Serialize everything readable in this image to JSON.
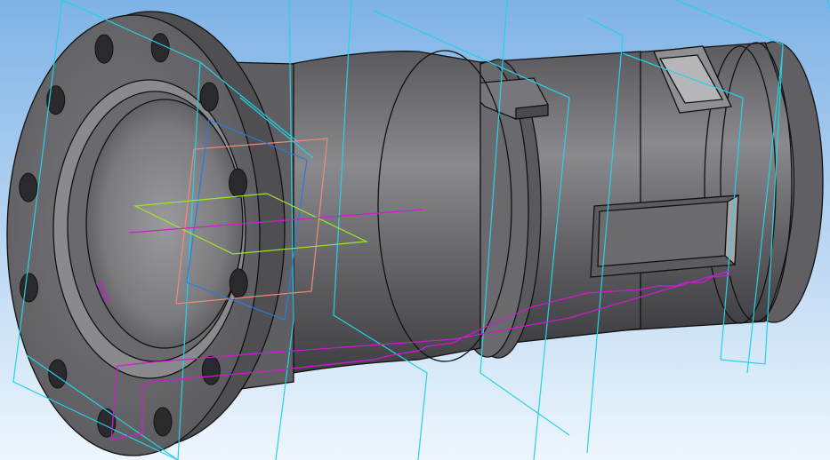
{
  "viewport": {
    "background_top": "#7fb3e6",
    "background_bottom": "#eef6fd"
  },
  "model": {
    "body_color": "#6f6f73",
    "body_dark": "#3c3c40",
    "body_light": "#a9a9ad",
    "edge_color": "#111111"
  },
  "overlays": {
    "plane_color": "#22d3e6",
    "sketch_magenta": "#d11ad1",
    "sketch_green": "#9be81f",
    "sketch_salmon": "#f08a7a",
    "sketch_blue": "#2a7bd6"
  },
  "flange": {
    "bolt_holes": 12
  }
}
